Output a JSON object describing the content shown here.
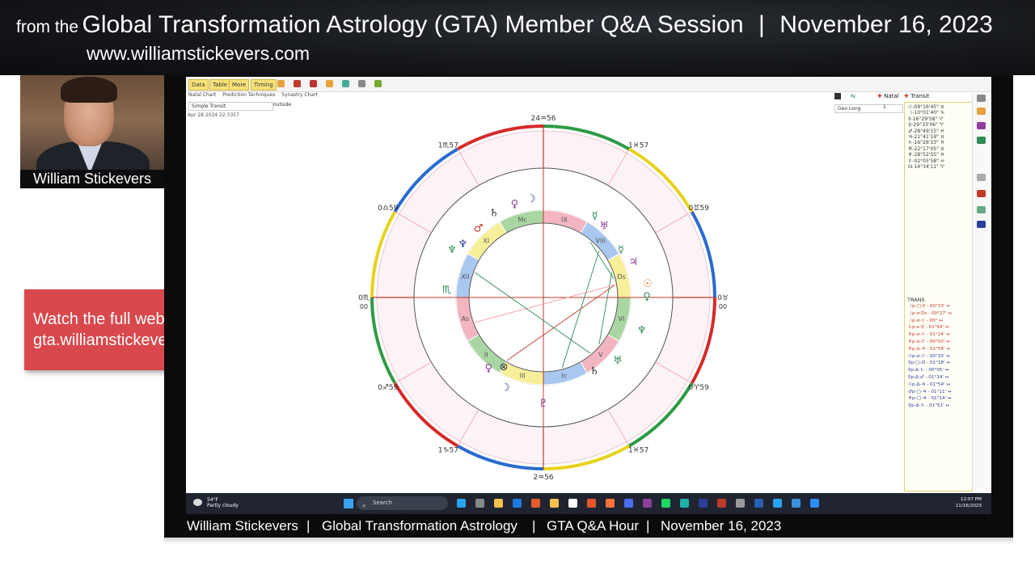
{
  "banner": {
    "prefix": "from the",
    "title": "Global Transformation Astrology (GTA) Member Q&A Session",
    "separator": "|",
    "date": "November 16, 2023",
    "url": "www.williamstickevers.com"
  },
  "presenter": {
    "name": "William Stickevers"
  },
  "promo": {
    "line1": "Watch the full webinar at",
    "line2": "gta.williamstickevers.com"
  },
  "app": {
    "toolbar_buttons": [
      "Data",
      "Table",
      "More",
      "Timing"
    ],
    "subtabs": [
      "Natal Chart",
      "Prediction Techniques",
      "Synastry Chart"
    ],
    "transit_mode": "Simple Transit",
    "outside_label": "outside",
    "chart_datetime": "Apr 28 2024 22:3357",
    "natal_label": "Natal",
    "transit_label": "Transit",
    "geo_long": "Geo Long",
    "geo_num": "1",
    "positions": [
      "☉-09°16'45\" ♉",
      "☽-10°01'40\" ♑",
      "☿-16°29'58\" ♈",
      "♀-29°33'06\" ♈",
      "♂-28°49'15\" ♓",
      "♃-21°41'19\" ♉",
      "♄-16°26'33\" ♓",
      "♅-22°17'05\" ♉",
      "♆-28°52'55\" ♓",
      "♇-02°05'58\" ♒",
      "☊-14°34'11\" ♈"
    ],
    "trans_title": "TRANS",
    "aspects": [
      {
        "text": "☽p-□-☿ - 00°33' ↔",
        "color": "#c0392b"
      },
      {
        "text": "☽p-σ-Ds - 00°27' ↔",
        "color": "#c0392b"
      },
      {
        "text": "☽p-σ-☉ - 00° ↔",
        "color": "#c0392b"
      },
      {
        "text": "♄p-⚹-♀ - 01°54' ↔",
        "color": "#c0392b"
      },
      {
        "text": "♆p-σ-☉ - 01°24' ↔",
        "color": "#c0392b"
      },
      {
        "text": "♆p-σ-♇ - 00°50' ↔",
        "color": "#c0392b"
      },
      {
        "text": "♆p-Δ-♃ - 01°56' ↔",
        "color": "#c0392b"
      },
      {
        "text": "☉p-σ-☉ - 00°33' ↔",
        "color": "#2c3e9a"
      },
      {
        "text": "☿p-□-☊ - 01°18' ↔",
        "color": "#2c3e9a"
      },
      {
        "text": "☿p-Δ-♄ - 00°05' ↔",
        "color": "#2c3e9a"
      },
      {
        "text": "☿p-Δ-♂ - 01°14' ↔",
        "color": "#2c3e9a"
      },
      {
        "text": "☉p-Δ-♃ - 01°54' ↔",
        "color": "#2c3e9a"
      },
      {
        "text": "♂p-□-♃ - 01°11' ↔",
        "color": "#2c3e9a"
      },
      {
        "text": "♆p-□-♃ - 01°14' ↔",
        "color": "#2c3e9a"
      },
      {
        "text": "♀p-Δ-♄ - 01°51' ↔",
        "color": "#2c3e9a"
      }
    ]
  },
  "chart": {
    "signs": [
      "♈",
      "♉",
      "♊",
      "♋",
      "♌",
      "♍",
      "♎",
      "♏",
      "♐",
      "♑",
      "♒",
      "♓"
    ],
    "houses": [
      "As",
      "II",
      "III",
      "Ic",
      "V",
      "VI",
      "Ds",
      "VIII",
      "IX",
      "Mc",
      "XI",
      "XII"
    ],
    "cusp_labels": [
      {
        "t": "24♒56",
        "ang": -90
      },
      {
        "t": "1♓57",
        "ang": -58
      },
      {
        "t": "0♊59",
        "ang": -30
      },
      {
        "t": "0♉",
        "sub": "00",
        "ang": 0
      },
      {
        "t": "0♈59",
        "ang": 30
      },
      {
        "t": "1♓57",
        "ang": 58
      },
      {
        "t": "2♒56",
        "ang": 90
      },
      {
        "t": "1♑57",
        "ang": 122
      },
      {
        "t": "0♐59",
        "ang": 150
      },
      {
        "t": "0♏",
        "sub": "00",
        "ang": 180
      },
      {
        "t": "0♎59",
        "ang": 210
      },
      {
        "t": "1♏57",
        "ang": 238
      }
    ],
    "outer_planets": [
      {
        "g": "♄",
        "c": "#333",
        "ang": -120,
        "r": 152
      },
      {
        "g": "♀",
        "c": "#8e3d9b",
        "ang": -107,
        "r": 152
      },
      {
        "g": "☽",
        "c": "#2c3e9a",
        "ang": -97,
        "r": 154
      },
      {
        "g": "♂",
        "c": "#c0392b",
        "ang": -133,
        "r": 148
      },
      {
        "g": "♆",
        "c": "#2c3e9a",
        "ang": -146,
        "r": 150
      },
      {
        "g": "☿",
        "c": "#2e8b57",
        "ang": -58,
        "r": 150
      },
      {
        "g": "♅",
        "c": "#8e3d9b",
        "ang": -50,
        "r": 147
      },
      {
        "g": "☿",
        "c": "#2e8b57",
        "ang": -32,
        "r": 143
      },
      {
        "g": "♃",
        "c": "#8e3d9b",
        "ang": -22,
        "r": 150
      },
      {
        "g": "☉",
        "c": "#e67e22",
        "ang": -8,
        "r": 160
      },
      {
        "g": "♀",
        "c": "#2e8b57",
        "ang": -1,
        "r": 158
      },
      {
        "g": "♆",
        "c": "#2e8b57",
        "ang": 18,
        "r": 158
      },
      {
        "g": "♅",
        "c": "#2e8b57",
        "ang": 40,
        "r": 150
      },
      {
        "g": "♄",
        "c": "#333",
        "ang": 55,
        "r": 140
      },
      {
        "g": "♀",
        "c": "#8e3d9b",
        "ang": 128,
        "r": 140
      },
      {
        "g": "☽",
        "c": "#2c3e9a",
        "ang": 113,
        "r": 150
      },
      {
        "g": "♇",
        "c": "#8e3d9b",
        "ang": 90,
        "r": 160
      },
      {
        "g": "⊗",
        "c": "#333",
        "ang": 120,
        "r": 128
      },
      {
        "g": "♏",
        "c": "#2e8b57",
        "ang": -175,
        "r": 150
      },
      {
        "g": "♆",
        "c": "#2e8b57",
        "ang": -152,
        "r": 158
      }
    ]
  },
  "taskbar": {
    "weather_temp": "54°F",
    "weather_desc": "Partly cloudy",
    "search_placeholder": "Search",
    "time": "12:07 PM",
    "date": "11/16/2023"
  },
  "footer": {
    "name": "William Stickevers",
    "org": "Global Transformation Astrology",
    "show": "GTA Q&A Hour",
    "date": "November 16, 2023",
    "sep": "|"
  },
  "colors": {
    "promo_bg": "#d9484c",
    "banner_bg": "#111316",
    "fire": "#d62a2a",
    "earth": "#2e9b46",
    "air": "#e8d21c",
    "water": "#2a6bd1"
  }
}
